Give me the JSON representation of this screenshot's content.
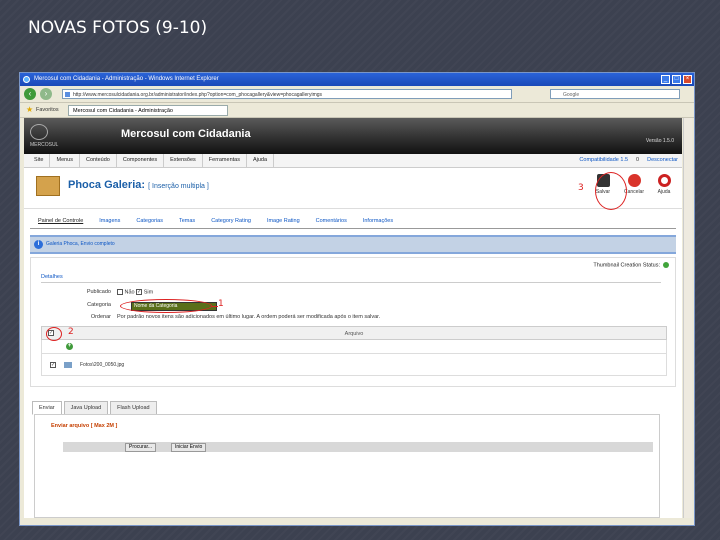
{
  "slide": {
    "title": "NOVAS FOTOS (9-10)"
  },
  "browser": {
    "title": "Mercosul com Cidadania - Administração - Windows Internet Explorer",
    "url": "http://www.mercosulcidadania.org.br/administrator/index.php?option=com_phocagallery&view=phocagalleryimgs",
    "search_placeholder": "Google",
    "favorites_label": "Favoritos",
    "tab_label": "Mercosul com Cidadania - Administração"
  },
  "joomla": {
    "site_name": "Mercosul com Cidadania",
    "logo_text": "MERCOSUL",
    "version": "Versão 1.5.0",
    "menu": [
      "Site",
      "Menus",
      "Conteúdo",
      "Componentes",
      "Extensões",
      "Ferramentas",
      "Ajuda"
    ],
    "status": {
      "preview": "Compatibilidade 1.5",
      "preview_count": "",
      "messages": "0",
      "logout": "Desconectar"
    }
  },
  "component": {
    "title": "Phoca Galeria:",
    "subtitle": "[ Inserção multipla ]",
    "buttons": {
      "save": "Salvar",
      "cancel": "Cancelar",
      "help": "Ajuda"
    },
    "tabs": [
      "Painel de Controle",
      "Imagens",
      "Categorias",
      "Temas",
      "Category Rating",
      "Image Rating",
      "Comentários",
      "Informações"
    ],
    "message": "Galeria Phoca, Envio completo"
  },
  "form": {
    "thumbnail_status_label": "Thumbnail Creation Status:",
    "legend": "Detalhes",
    "published_label": "Publicado",
    "published_no": "Não",
    "published_yes": "Sim",
    "category_label": "Categoria",
    "category_value": "Nome da Categoria",
    "ordering_label": "Ordenar",
    "ordering_note": "Por padrão novos itens são adicionados em último lugar. A ordem poderá ser modificada após o item salvar.",
    "column_header": "Arquivo",
    "file_row": "Fotos\\200_0050.jpg"
  },
  "upload": {
    "tabs": [
      "Enviar",
      "Java Upload",
      "Flash Upload"
    ],
    "title": "Enviar arquivo [ Max 2M ]",
    "browse_label": "Procurar...",
    "send_label": "Iniciar Envio"
  },
  "annotations": {
    "one": "1",
    "two": "2",
    "three": "3"
  },
  "colors": {
    "joomla_header": "#1e1e1e",
    "link_blue": "#0b55c4",
    "annotation_red": "#d22222",
    "category_select": "#5a6f1a"
  }
}
